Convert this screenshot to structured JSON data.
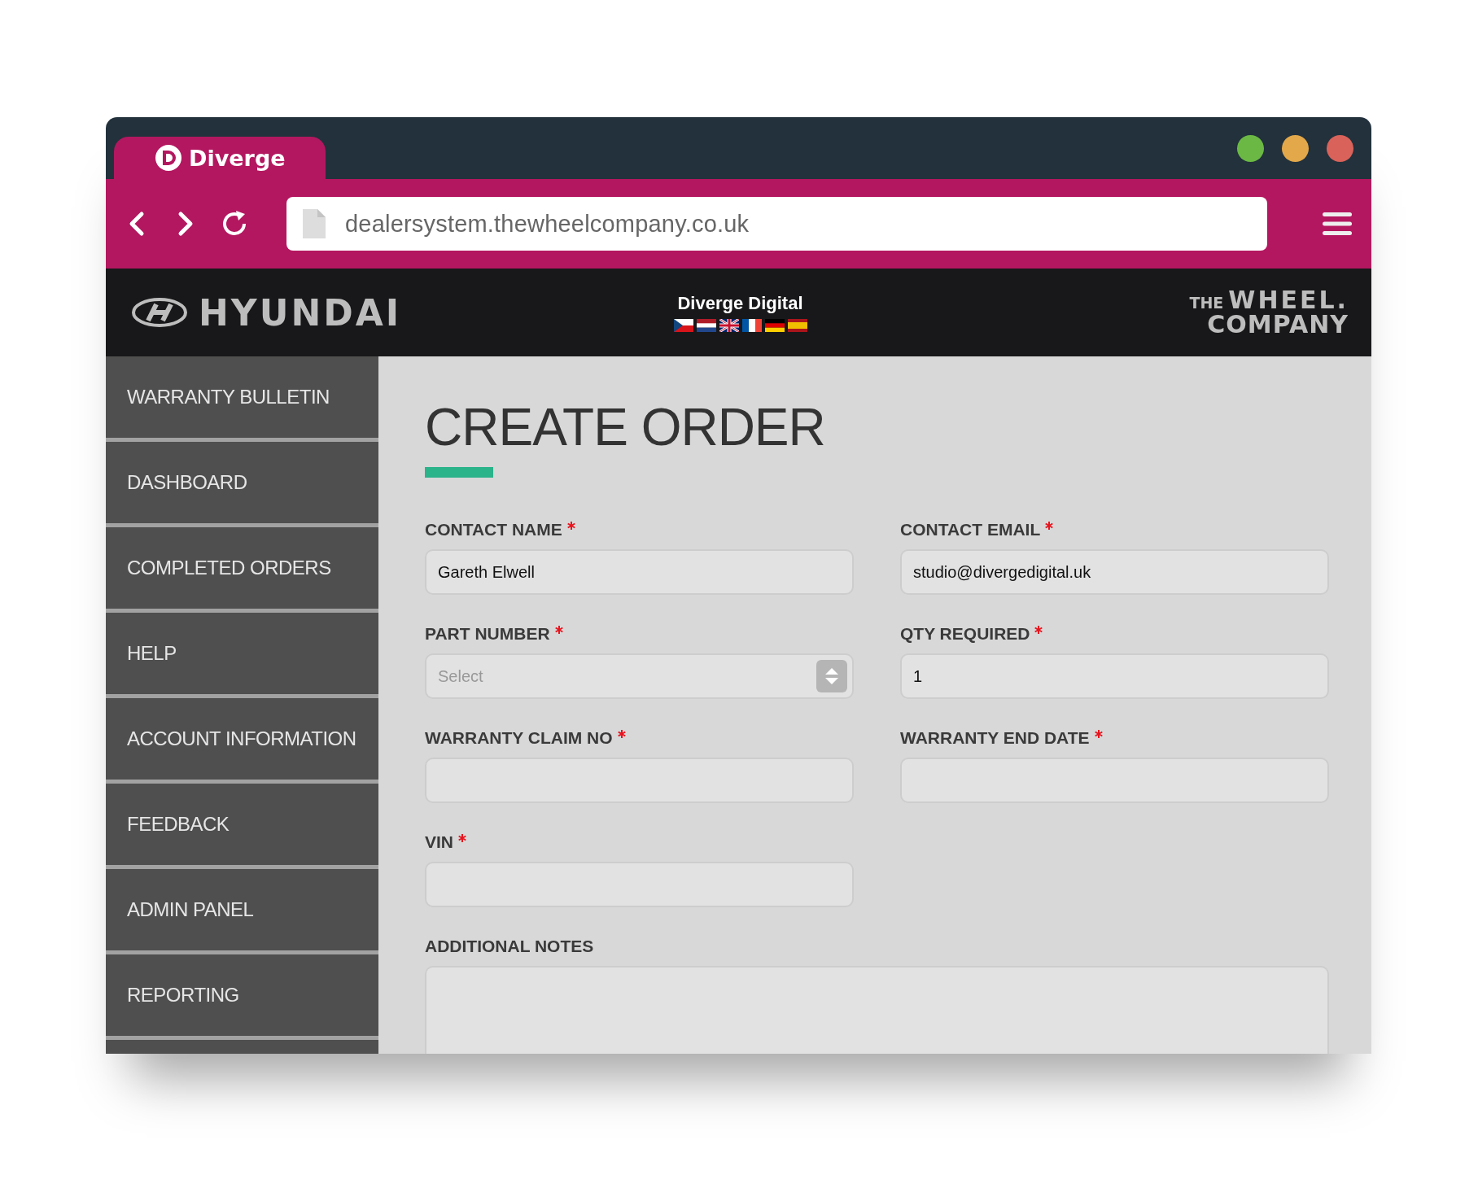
{
  "browser": {
    "tab": {
      "title": "Diverge"
    },
    "window_controls": [
      {
        "color": "#6bb944"
      },
      {
        "color": "#e2a84a"
      },
      {
        "color": "#d9625a"
      }
    ],
    "address_bar": {
      "value": "dealersystem.thewheelcompany.co.uk"
    }
  },
  "header": {
    "brand": "HYUNDAI",
    "center_title": "Diverge Digital",
    "flags": [
      {
        "kind": "cz"
      },
      {
        "kind": "nl"
      },
      {
        "kind": "gb"
      },
      {
        "kind": "fr"
      },
      {
        "kind": "de"
      },
      {
        "kind": "es"
      }
    ],
    "partner_logo": {
      "small": "THE",
      "big": "WHEEL.",
      "second_line": "COMPANY"
    }
  },
  "sidebar": {
    "items": [
      {
        "label": "WARRANTY BULLETIN",
        "selected": false
      },
      {
        "label": "DASHBOARD",
        "selected": false
      },
      {
        "label": "COMPLETED ORDERS",
        "selected": false
      },
      {
        "label": "HELP",
        "selected": false
      },
      {
        "label": "ACCOUNT INFORMATION",
        "selected": false
      },
      {
        "label": "FEEDBACK",
        "selected": false
      },
      {
        "label": "ADMIN PANEL",
        "selected": false
      },
      {
        "label": "REPORTING",
        "selected": false
      }
    ]
  },
  "form": {
    "title": "CREATE ORDER",
    "fields": [
      {
        "kind": "text",
        "label": "CONTACT NAME",
        "required": true,
        "value": "Gareth Elwell"
      },
      {
        "kind": "text",
        "label": "CONTACT EMAIL",
        "required": true,
        "value": "studio@divergedigital.uk"
      },
      {
        "kind": "select",
        "label": "PART NUMBER",
        "required": true,
        "placeholder": "Select"
      },
      {
        "kind": "text",
        "label": "QTY REQUIRED",
        "required": true,
        "value": "1"
      },
      {
        "kind": "text",
        "label": "WARRANTY CLAIM NO",
        "required": true
      },
      {
        "kind": "text",
        "label": "WARRANTY END DATE",
        "required": true
      },
      {
        "kind": "text",
        "label": "VIN",
        "required": true
      },
      {
        "kind": "textarea",
        "label": "ADDITIONAL NOTES",
        "required": false
      }
    ]
  }
}
